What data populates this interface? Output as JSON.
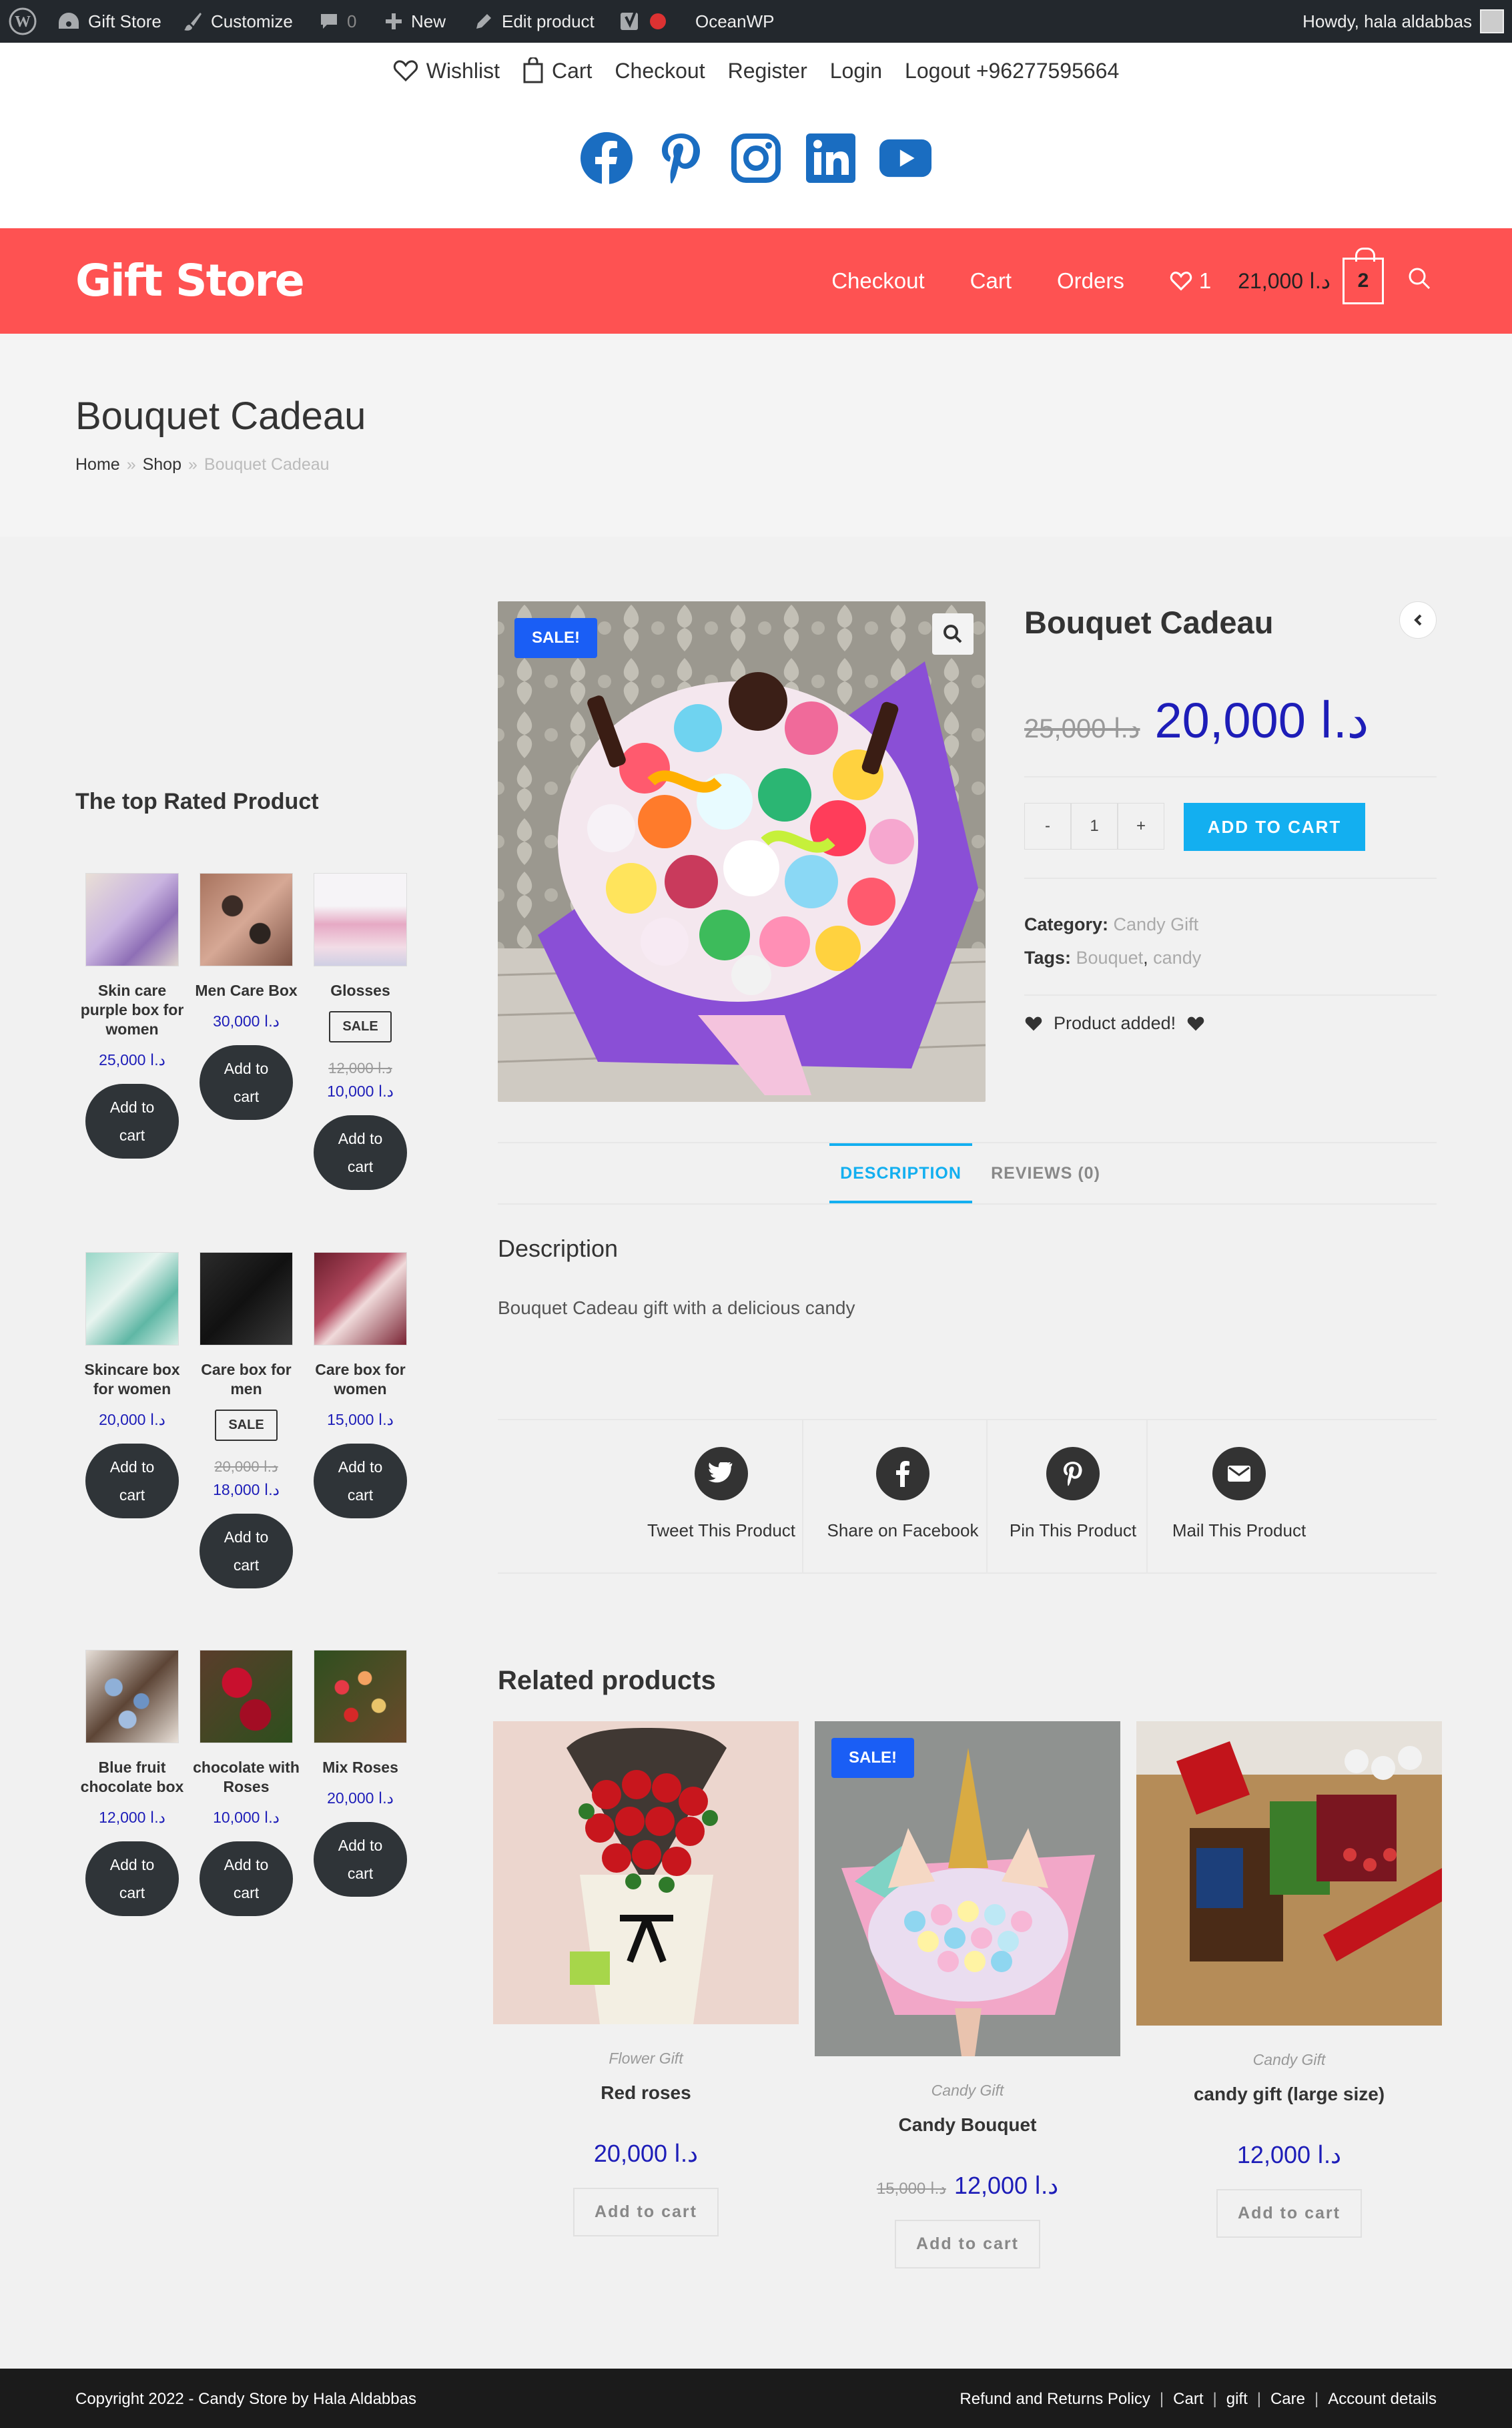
{
  "adminbar": {
    "site": "Gift Store",
    "customize": "Customize",
    "comments": "0",
    "new": "New",
    "edit": "Edit product",
    "theme": "OceanWP",
    "howdy": "Howdy, hala aldabbas"
  },
  "topmenu": {
    "wishlist": "Wishlist",
    "cart": "Cart",
    "checkout": "Checkout",
    "register": "Register",
    "login": "Login",
    "logout": "Logout +96277595664"
  },
  "social": [
    "facebook",
    "pinterest",
    "instagram",
    "linkedin",
    "youtube"
  ],
  "brand": {
    "logo": "Gift Store",
    "color": "#fe5252"
  },
  "nav": {
    "checkout": "Checkout",
    "cart": "Cart",
    "orders": "Orders",
    "wishlist_count": "1",
    "cart_total": "21,000 د.ا",
    "cart_count": "2"
  },
  "page": {
    "title": "Bouquet Cadeau",
    "breadcrumb": {
      "home": "Home",
      "sep": "»",
      "shop": "Shop",
      "current": "Bouquet Cadeau"
    }
  },
  "sidebar": {
    "title": "The top Rated Product",
    "products": [
      {
        "name": "Skin care purple box for women",
        "price": "25,000 د.ا",
        "btn": "Add to cart"
      },
      {
        "name": "Men Care Box",
        "price": "30,000 د.ا",
        "btn": "Add to cart"
      },
      {
        "name": "Glosses",
        "sale": "SALE",
        "old_price": "12,000 د.ا",
        "price": "10,000 د.ا",
        "btn": "Add to cart"
      },
      {
        "name": "Skincare box for women",
        "price": "20,000 د.ا",
        "btn": "Add to cart"
      },
      {
        "name": "Care box for men",
        "sale": "SALE",
        "old_price": "20,000 د.ا",
        "price": "18,000 د.ا",
        "btn": "Add to cart"
      },
      {
        "name": "Care box for women",
        "price": "15,000 د.ا",
        "btn": "Add to cart"
      },
      {
        "name": "Blue fruit chocolate box",
        "price": "12,000 د.ا",
        "btn": "Add to cart"
      },
      {
        "name": "chocolate with Roses",
        "price": "10,000 د.ا",
        "btn": "Add to cart"
      },
      {
        "name": "Mix Roses",
        "price": "20,000 د.ا",
        "btn": "Add to cart"
      }
    ]
  },
  "product": {
    "sale_badge": "SALE!",
    "title": "Bouquet Cadeau",
    "old_price": "25,000 د.ا",
    "price": "20,000 د.ا",
    "qty_minus": "-",
    "qty": "1",
    "qty_plus": "+",
    "add_to_cart": "ADD TO CART",
    "category_label": "Category:",
    "category": "Candy Gift",
    "tags_label": "Tags:",
    "tag1": "Bouquet",
    "tag_sep": ",",
    "tag2": "candy",
    "added": "Product added!"
  },
  "tabs": {
    "description": "DESCRIPTION",
    "reviews": "REVIEWS (0)"
  },
  "description": {
    "heading": "Description",
    "text": "Bouquet Cadeau  gift with a delicious candy"
  },
  "share": {
    "tweet": "Tweet This Product",
    "facebook": "Share on Facebook",
    "pin": "Pin This Product",
    "mail": "Mail This Product"
  },
  "related": {
    "title": "Related products",
    "items": [
      {
        "category": "Flower Gift",
        "name": "Red roses",
        "price": "20,000 د.ا",
        "btn": "Add to cart"
      },
      {
        "sale": "SALE!",
        "category": "Candy Gift",
        "name": "Candy Bouquet",
        "old_price": "15,000 د.ا",
        "price": "12,000 د.ا",
        "btn": "Add to cart"
      },
      {
        "category": "Candy Gift",
        "name": "candy gift (large size)",
        "price": "12,000 د.ا",
        "btn": "Add to cart"
      }
    ]
  },
  "footer": {
    "copyright": "Copyright 2022 - Candy Store by Hala Aldabbas",
    "links": [
      "Refund and Returns Policy",
      "Cart",
      "gift",
      "Care",
      "Account details"
    ],
    "sep": "|"
  }
}
